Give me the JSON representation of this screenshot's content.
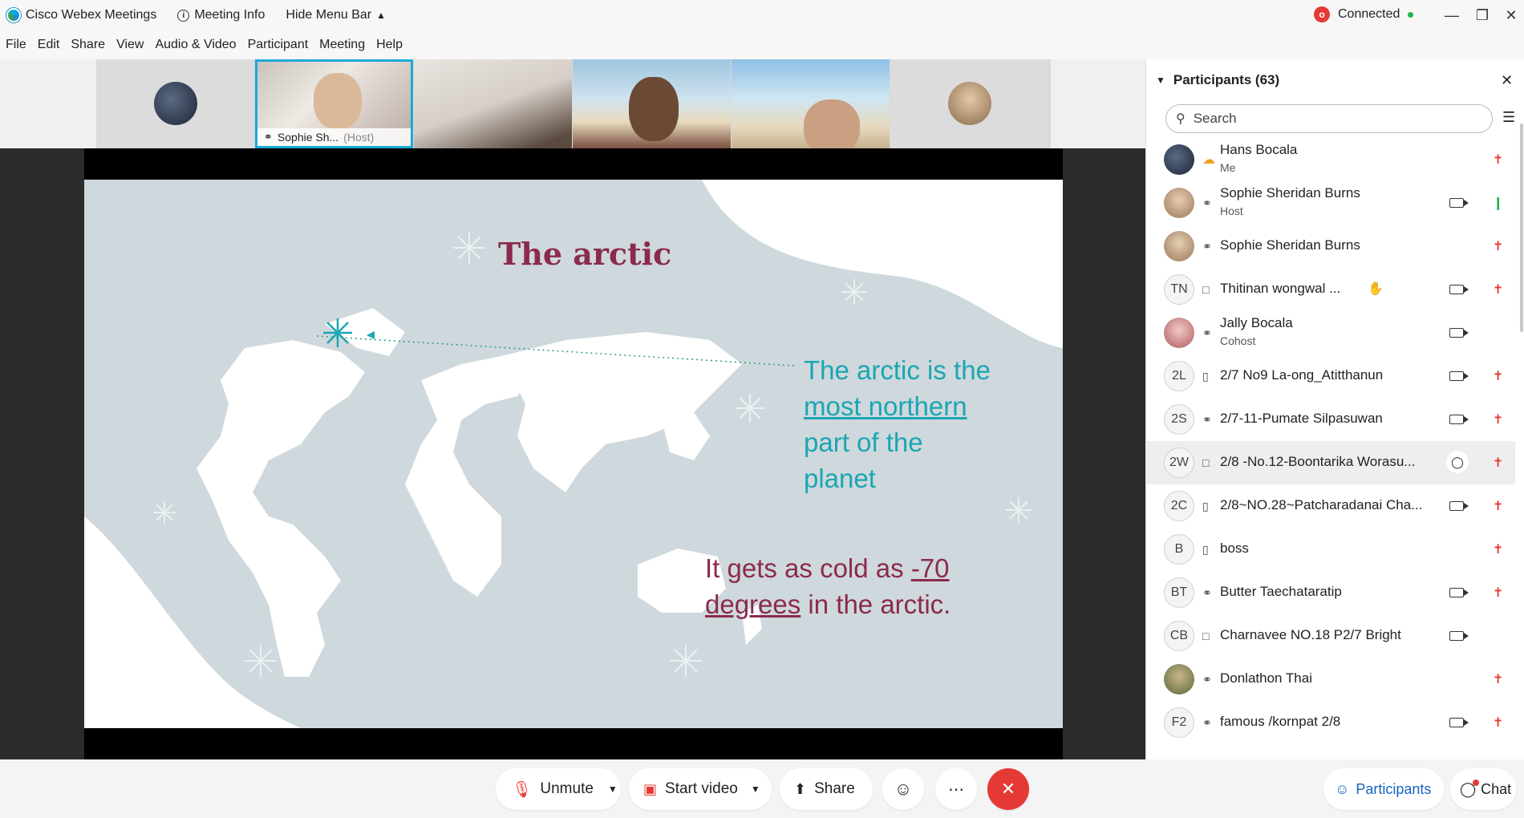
{
  "titlebar": {
    "app_title": "Cisco Webex Meetings",
    "meeting_info": "Meeting Info",
    "hide_menu": "Hide Menu Bar",
    "rec_badge": "o",
    "status": "Connected"
  },
  "menu": [
    "File",
    "Edit",
    "Share",
    "View",
    "Audio & Video",
    "Participant",
    "Meeting",
    "Help"
  ],
  "filmstrip": {
    "active_name": "Sophie Sh...",
    "active_role": "(Host)"
  },
  "slide": {
    "title": "The arctic",
    "fact1_a": "The arctic is the",
    "fact1_b": "most northern",
    "fact1_c": "part of the",
    "fact1_d": "planet",
    "fact2_a": "It gets as cold as ",
    "fact2_b": "-70",
    "fact2_c": "degrees",
    "fact2_d": " in the arctic."
  },
  "toolbar": {
    "unmute": "Unmute",
    "start_video": "Start video",
    "share": "Share"
  },
  "panel": {
    "title": "Participants (63)",
    "search_placeholder": "Search",
    "participants": [
      {
        "initials": "",
        "name": "Hans Bocala",
        "sub": "Me"
      },
      {
        "initials": "",
        "name": "Sophie Sheridan Burns",
        "sub": "Host"
      },
      {
        "initials": "",
        "name": "Sophie Sheridan Burns",
        "sub": ""
      },
      {
        "initials": "TN",
        "name": "Thitinan wongwal ...",
        "sub": ""
      },
      {
        "initials": "",
        "name": "Jally Bocala",
        "sub": "Cohost"
      },
      {
        "initials": "2L",
        "name": "2/7 No9 La-ong_Atitthanun",
        "sub": ""
      },
      {
        "initials": "2S",
        "name": "2/7-11-Pumate Silpasuwan",
        "sub": ""
      },
      {
        "initials": "2W",
        "name": "2/8 -No.12-Boontarika Worasu...",
        "sub": ""
      },
      {
        "initials": "2C",
        "name": "2/8~NO.28~Patcharadanai Cha...",
        "sub": ""
      },
      {
        "initials": "B",
        "name": "boss",
        "sub": ""
      },
      {
        "initials": "BT",
        "name": "Butter Taechataratip",
        "sub": ""
      },
      {
        "initials": "CB",
        "name": "Charnavee NO.18 P2/7 Bright",
        "sub": ""
      },
      {
        "initials": "",
        "name": "Donlathon Thai",
        "sub": ""
      },
      {
        "initials": "F2",
        "name": "famous /kornpat 2/8",
        "sub": ""
      }
    ]
  },
  "footer": {
    "participants_btn": "Participants",
    "chat_btn": "Chat"
  },
  "colors": {
    "slide_title": "#8b2a4e",
    "slide_teal": "#1aa6b3",
    "end_red": "#e53935",
    "accent_blue": "#1565c0"
  }
}
